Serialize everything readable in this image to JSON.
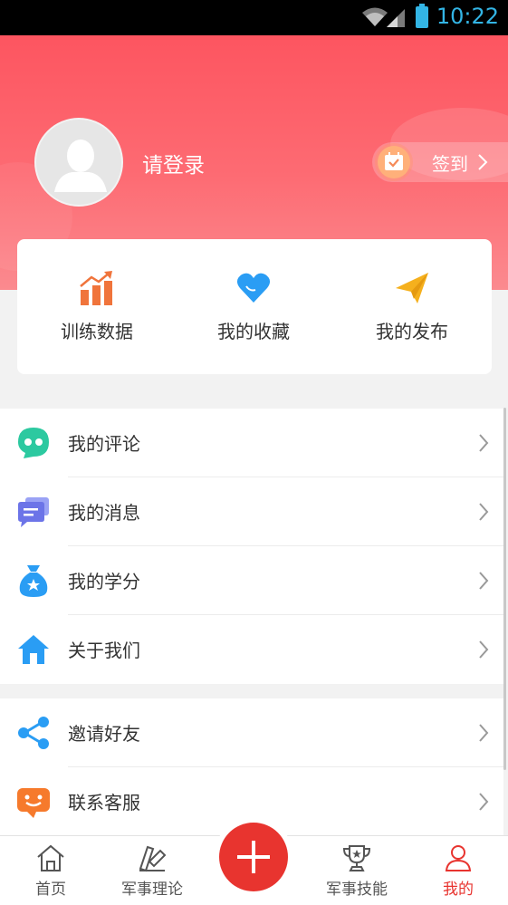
{
  "status_bar": {
    "time": "10:22",
    "icons": [
      "wifi-icon",
      "signal-icon",
      "battery-icon"
    ]
  },
  "profile": {
    "login_prompt": "请登录",
    "avatar_icon": "user-avatar-icon"
  },
  "signin": {
    "label": "签到",
    "icon": "calendar-check-icon"
  },
  "quick_actions": [
    {
      "label": "训练数据",
      "icon": "bar-chart-trend-icon",
      "color": "#f0743b"
    },
    {
      "label": "我的收藏",
      "icon": "heart-icon",
      "color": "#2a9df4"
    },
    {
      "label": "我的发布",
      "icon": "paper-plane-icon",
      "color": "#f5b01d"
    }
  ],
  "menu_group1": [
    {
      "label": "我的评论",
      "icon": "comment-bubble-icon",
      "color": "#2cc9a0"
    },
    {
      "label": "我的消息",
      "icon": "message-icon",
      "color": "#6c74e8"
    },
    {
      "label": "我的学分",
      "icon": "money-bag-icon",
      "color": "#2a9df4"
    },
    {
      "label": "关于我们",
      "icon": "home-icon",
      "color": "#2a9df4"
    }
  ],
  "menu_group2": [
    {
      "label": "邀请好友",
      "icon": "share-icon",
      "color": "#2a9df4"
    },
    {
      "label": "联系客服",
      "icon": "customer-service-icon",
      "color": "#f67a2c"
    }
  ],
  "tabs": [
    {
      "label": "首页",
      "icon": "home-outline-icon",
      "active": false
    },
    {
      "label": "军事理论",
      "icon": "book-theory-icon",
      "active": false
    },
    {
      "label": "军事技能",
      "icon": "trophy-icon",
      "active": false
    },
    {
      "label": "我的",
      "icon": "user-outline-icon",
      "active": true
    }
  ],
  "fab": {
    "icon": "plus-icon"
  },
  "colors": {
    "header": "#fd5560",
    "accent": "#e8342f"
  }
}
